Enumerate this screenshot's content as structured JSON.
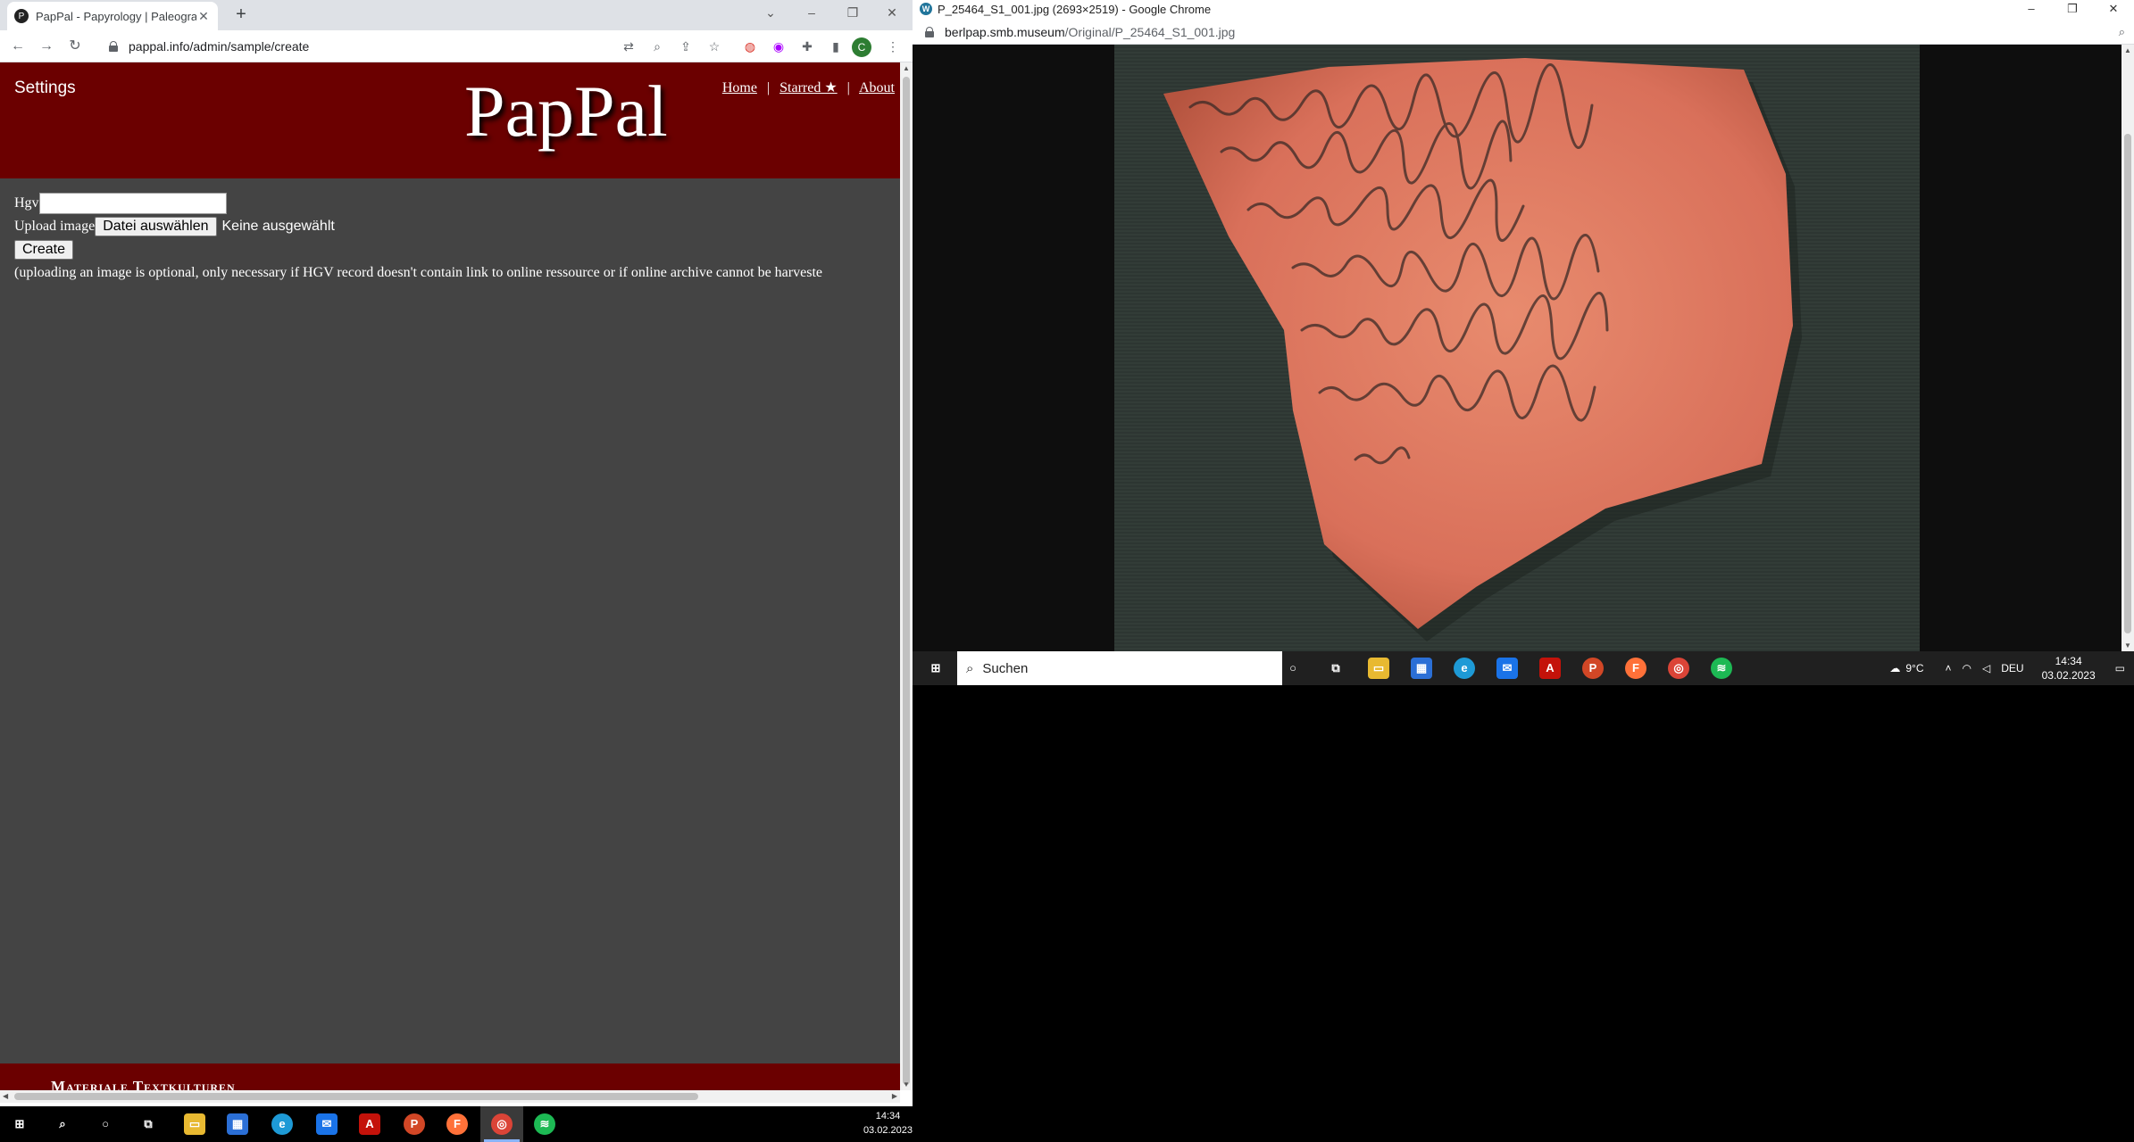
{
  "left_browser": {
    "tab_title": "PapPal - Papyrology | Paleography",
    "url": "pappal.info/admin/sample/create",
    "profile_initial": "C",
    "site": {
      "settings_label": "Settings",
      "brand": "PapPal",
      "nav": {
        "home": "Home",
        "starred": "Starred ★",
        "about": "About",
        "separator": "|"
      },
      "form": {
        "hgv_label": "Hgv",
        "hgv_value": "",
        "upload_label": "Upload image",
        "file_button": "Datei auswählen",
        "file_status": "Keine ausgewählt",
        "create_button": "Create",
        "note": "(uploading an image is optional, only necessary if HGV record doesn't contain link to online ressource or if online archive cannot be harveste"
      },
      "footer_text": "Materiale Textkulturen"
    }
  },
  "right_browser": {
    "window_title": "P_25464_S1_001.jpg (2693×2519) - Google Chrome",
    "url_domain": "berlpap.smb.museum",
    "url_path": "/Original/P_25464_S1_001.jpg",
    "image_description_icon": "ostracon-image"
  },
  "taskbar_secondary": {
    "search_placeholder": "Suchen",
    "weather": "9°C",
    "language": "DEU",
    "time": "14:34",
    "date": "03.02.2023"
  },
  "taskbar_main": {
    "time": "14:34",
    "date": "03.02.2023"
  }
}
